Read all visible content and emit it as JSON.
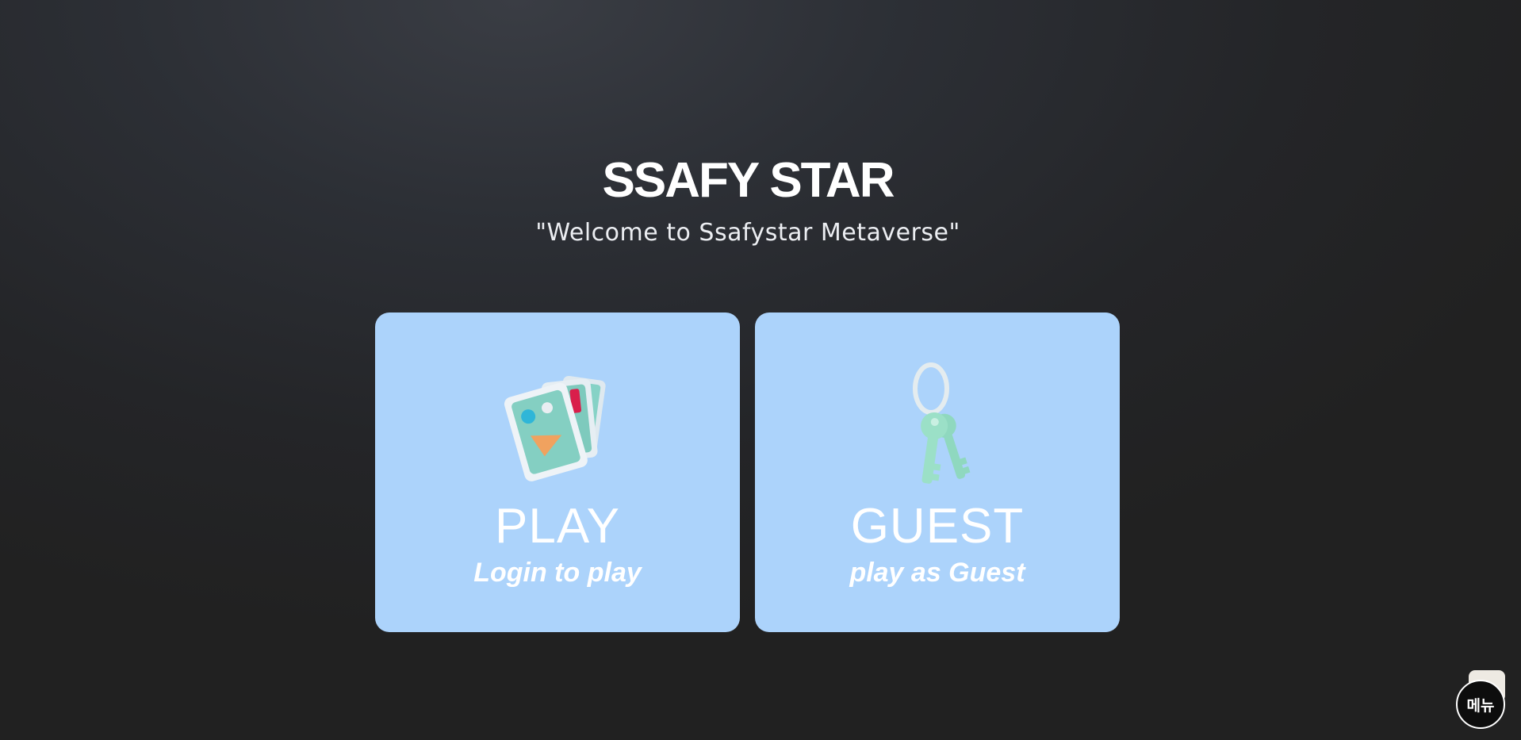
{
  "header": {
    "title": "SSAFY STAR",
    "subtitle": "\"Welcome to Ssafystar Metaverse\""
  },
  "cards": {
    "play": {
      "label": "PLAY",
      "sub": "Login to play",
      "icon": "photo-cards-icon"
    },
    "guest": {
      "label": "GUEST",
      "sub": "play as Guest",
      "icon": "keys-icon"
    }
  },
  "menu": {
    "label": "메뉴"
  },
  "colors": {
    "card_background": "#acd3fb",
    "page_background": "#2a2c30"
  }
}
